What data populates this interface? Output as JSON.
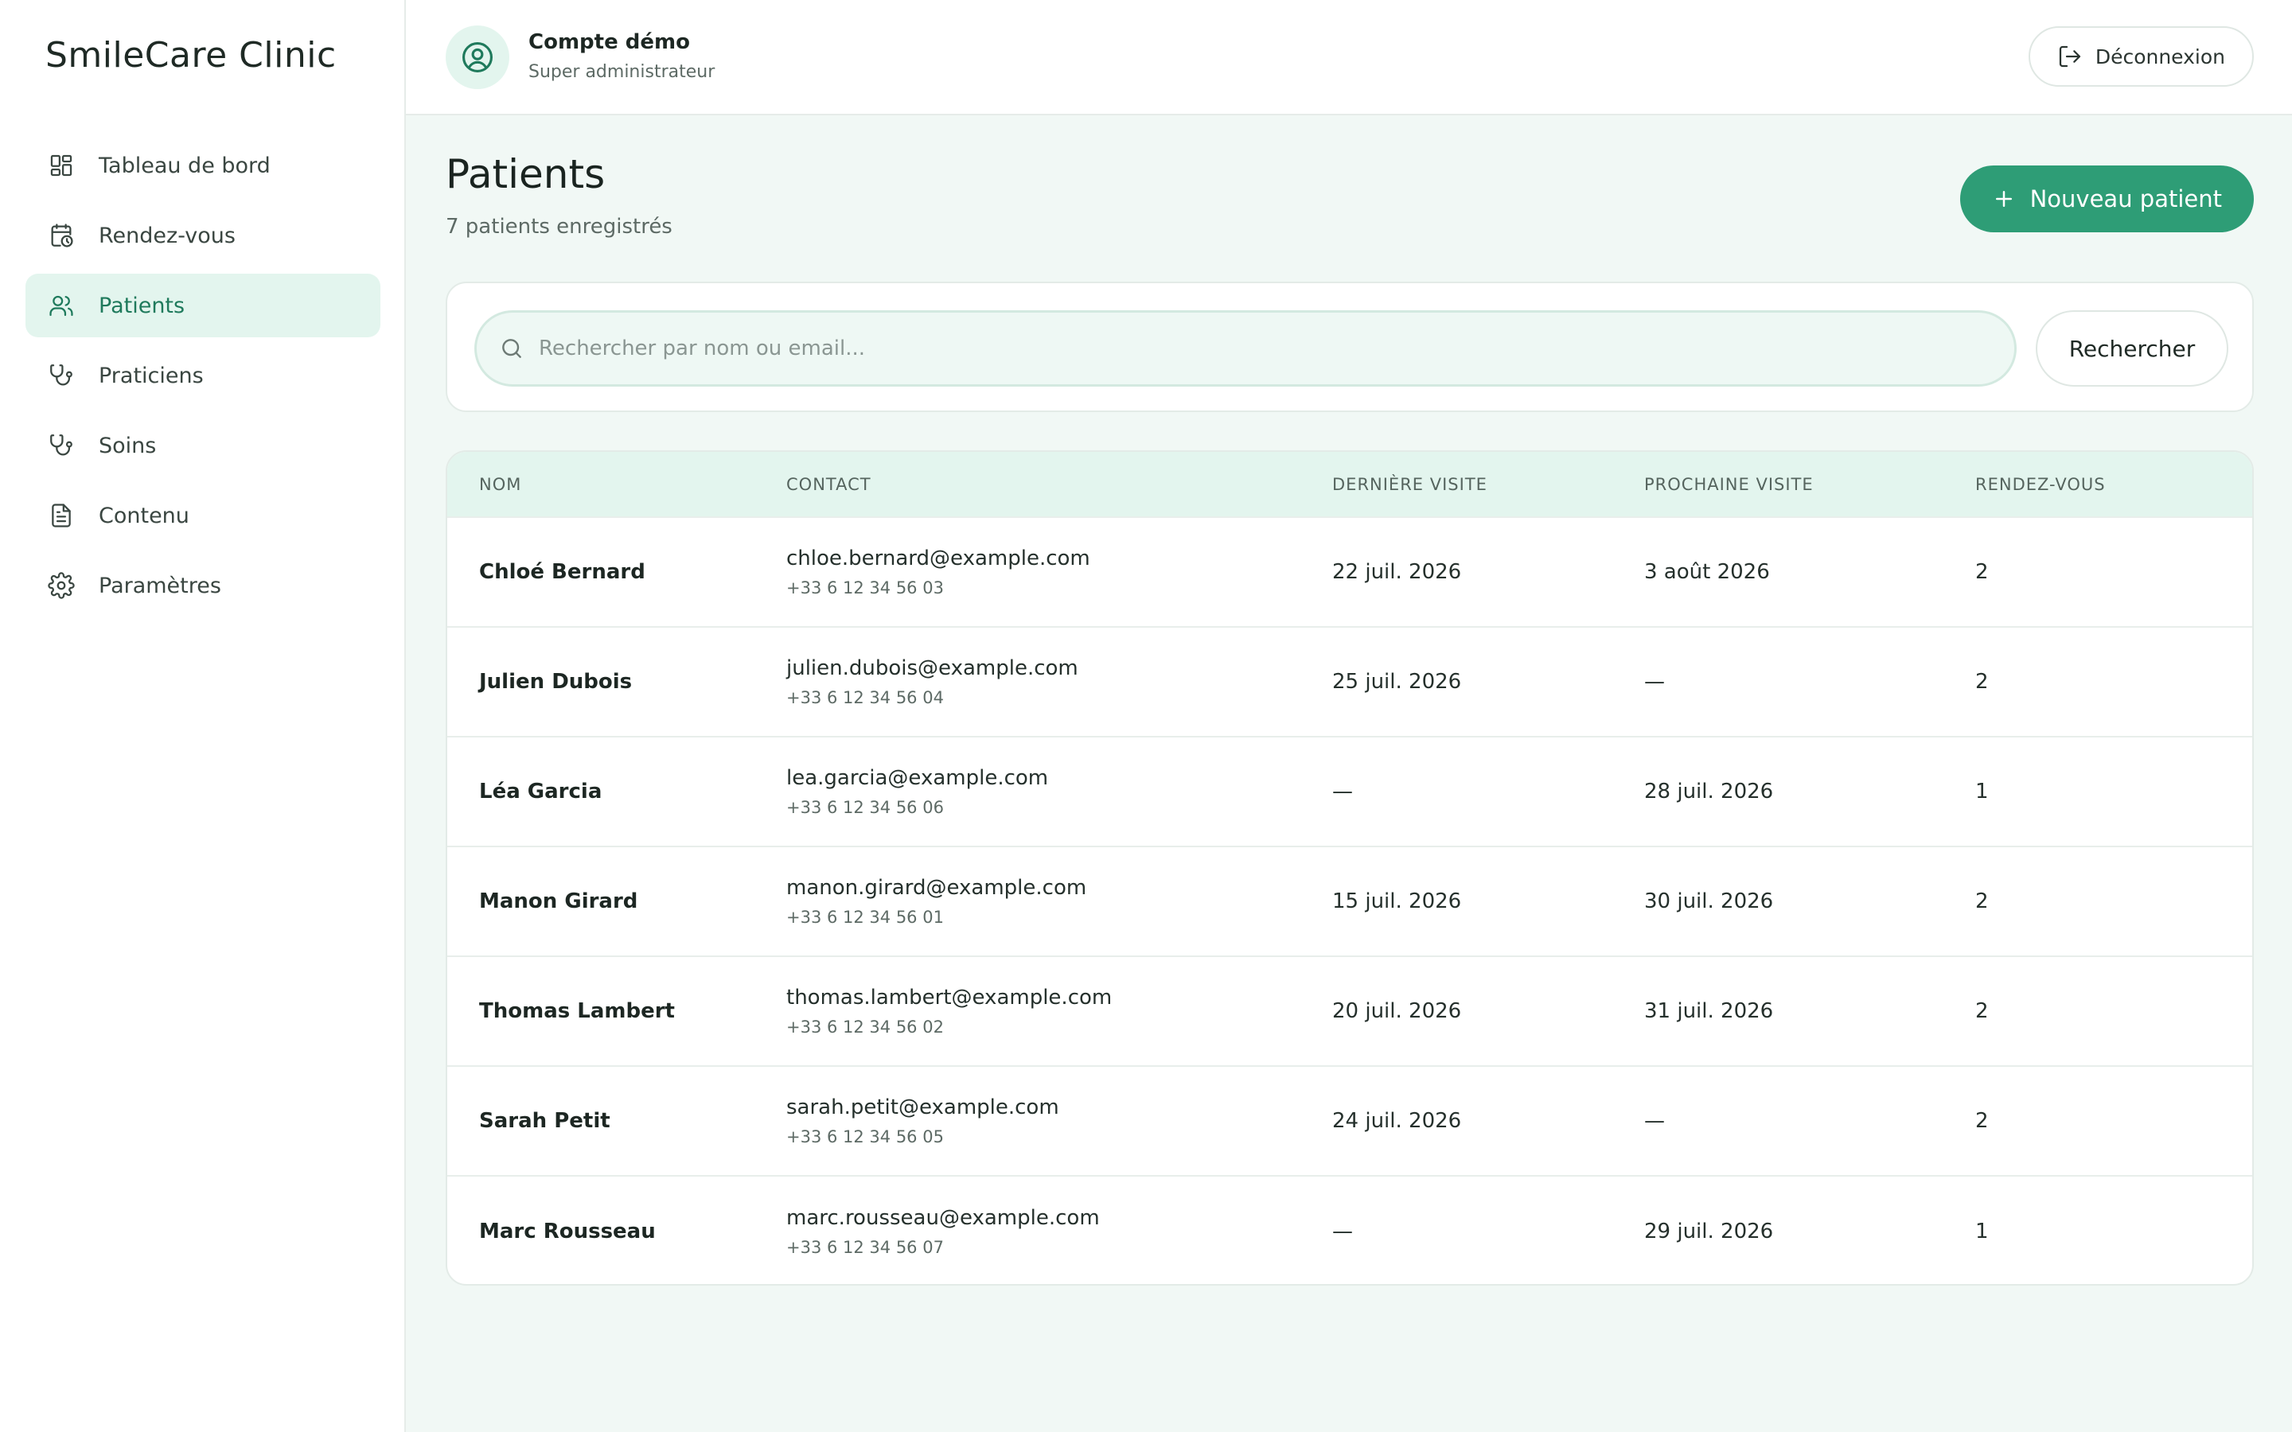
{
  "app": {
    "brand": "SmileCare Clinic"
  },
  "sidebar": {
    "items": [
      {
        "label": "Tableau de bord",
        "icon": "dashboard-icon"
      },
      {
        "label": "Rendez-vous",
        "icon": "calendar-clock-icon"
      },
      {
        "label": "Patients",
        "icon": "users-icon",
        "active": true
      },
      {
        "label": "Praticiens",
        "icon": "stethoscope-icon"
      },
      {
        "label": "Soins",
        "icon": "stethoscope-icon"
      },
      {
        "label": "Contenu",
        "icon": "document-icon"
      },
      {
        "label": "Paramètres",
        "icon": "gear-icon"
      }
    ]
  },
  "header": {
    "account_name": "Compte démo",
    "account_role": "Super administrateur",
    "logout_label": "Déconnexion"
  },
  "main": {
    "title": "Patients",
    "subtitle": "7 patients enregistrés",
    "new_button_label": "Nouveau patient",
    "search": {
      "placeholder": "Rechercher par nom ou email...",
      "value": "",
      "button_label": "Rechercher"
    },
    "table": {
      "columns": [
        "NOM",
        "CONTACT",
        "DERNIÈRE VISITE",
        "PROCHAINE VISITE",
        "RENDEZ-VOUS"
      ],
      "rows": [
        {
          "name": "Chloé Bernard",
          "email": "chloe.bernard@example.com",
          "phone": "+33 6 12 34 56 03",
          "last_visit": "22 juil. 2026",
          "next_visit": "3 août 2026",
          "appointments": "2"
        },
        {
          "name": "Julien Dubois",
          "email": "julien.dubois@example.com",
          "phone": "+33 6 12 34 56 04",
          "last_visit": "25 juil. 2026",
          "next_visit": "—",
          "appointments": "2"
        },
        {
          "name": "Léa Garcia",
          "email": "lea.garcia@example.com",
          "phone": "+33 6 12 34 56 06",
          "last_visit": "—",
          "next_visit": "28 juil. 2026",
          "appointments": "1"
        },
        {
          "name": "Manon Girard",
          "email": "manon.girard@example.com",
          "phone": "+33 6 12 34 56 01",
          "last_visit": "15 juil. 2026",
          "next_visit": "30 juil. 2026",
          "appointments": "2"
        },
        {
          "name": "Thomas Lambert",
          "email": "thomas.lambert@example.com",
          "phone": "+33 6 12 34 56 02",
          "last_visit": "20 juil. 2026",
          "next_visit": "31 juil. 2026",
          "appointments": "2"
        },
        {
          "name": "Sarah Petit",
          "email": "sarah.petit@example.com",
          "phone": "+33 6 12 34 56 05",
          "last_visit": "24 juil. 2026",
          "next_visit": "—",
          "appointments": "2"
        },
        {
          "name": "Marc Rousseau",
          "email": "marc.rousseau@example.com",
          "phone": "+33 6 12 34 56 07",
          "last_visit": "—",
          "next_visit": "29 juil. 2026",
          "appointments": "1"
        }
      ]
    }
  },
  "colors": {
    "accent": "#2e9d76",
    "accent_light": "#e3f5ee",
    "background": "#f1f8f5",
    "text": "#1d2723",
    "muted": "#5d6a65"
  }
}
